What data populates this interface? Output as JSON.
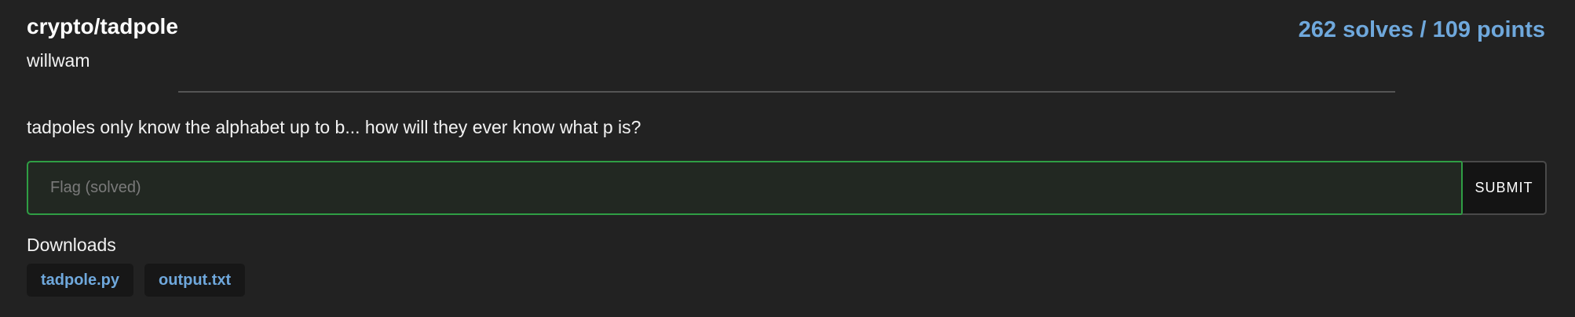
{
  "challenge": {
    "title": "crypto/tadpole",
    "author": "willwam",
    "stats": "262 solves / 109 points",
    "description": "tadpoles only know the alphabet up to b... how will they ever know what p is?"
  },
  "flag_form": {
    "placeholder": "Flag (solved)",
    "value": "",
    "submit_label": "SUBMIT"
  },
  "downloads": {
    "heading": "Downloads",
    "files": [
      "tadpole.py",
      "output.txt"
    ]
  },
  "colors": {
    "background": "#222222",
    "accent": "#6fa8dc",
    "solved_border": "#2f9e44"
  }
}
